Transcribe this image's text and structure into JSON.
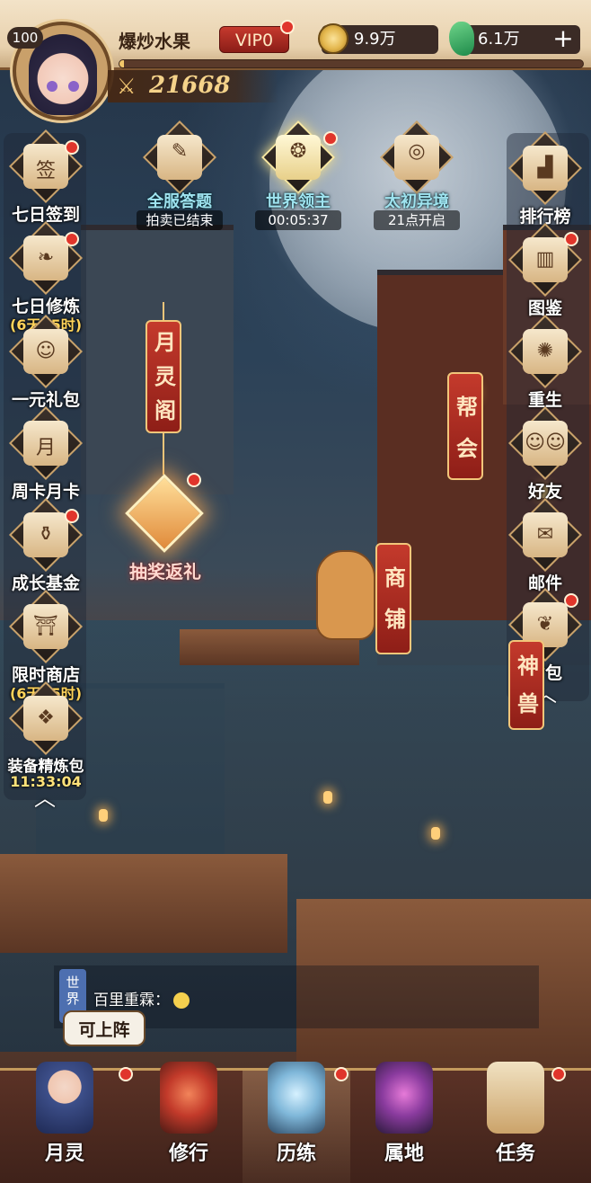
{
  "player": {
    "level": "100",
    "name": "爆炒水果",
    "vip": "VIP0",
    "power": "21668",
    "exp_fraction": 0.01
  },
  "resources": {
    "coins": "9.9万",
    "jade": "6.1万",
    "add_label": "+"
  },
  "activities": [
    {
      "label": "全服答题",
      "sub": "拍卖已结束"
    },
    {
      "label": "世界领主",
      "sub": "00:05:37"
    },
    {
      "label": "太初异境",
      "sub": "21点开启"
    }
  ],
  "left_menu": [
    {
      "label": "七日签到",
      "sub": ""
    },
    {
      "label": "七日修炼",
      "sub": "(6天05时)"
    },
    {
      "label": "一元礼包",
      "sub": ""
    },
    {
      "label": "周卡月卡",
      "sub": ""
    },
    {
      "label": "成长基金",
      "sub": ""
    },
    {
      "label": "限时商店",
      "sub": "(6天05时)"
    },
    {
      "label": "装备精炼包",
      "sub": "11:33:04"
    }
  ],
  "right_menu": [
    {
      "label": "排行榜"
    },
    {
      "label": "图鉴"
    },
    {
      "label": "重生"
    },
    {
      "label": "好友"
    },
    {
      "label": "邮件"
    },
    {
      "label": "背包"
    }
  ],
  "banners": {
    "moon_pavilion": "月灵阁",
    "guild": "帮会",
    "shop": "商铺",
    "divine_beast": "神兽",
    "draw_gift": "抽奖返礼"
  },
  "chat": {
    "channel": "世界",
    "line": "百里重霖：",
    "bubble": "可上阵"
  },
  "bottom_nav": [
    {
      "label": "月灵"
    },
    {
      "label": "修行"
    },
    {
      "label": "历练"
    },
    {
      "label": "属地"
    },
    {
      "label": "任务"
    }
  ],
  "colors": {
    "accent_red": "#e0352b",
    "gold": "#f5d38a",
    "cyan_label": "#9fe4f0",
    "timer_yellow": "#ffd45a"
  }
}
